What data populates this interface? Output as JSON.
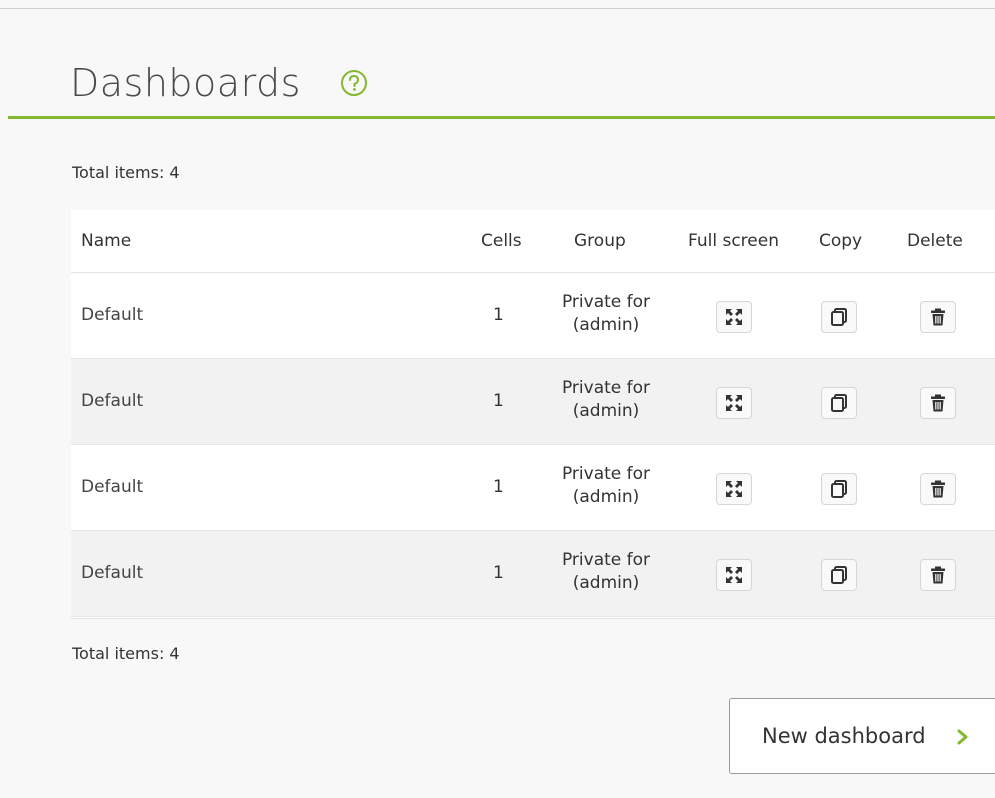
{
  "page": {
    "title": "Dashboards",
    "help_icon": "help-circle-icon",
    "accent_color": "#82b92e"
  },
  "summary": {
    "total_top": "Total items: 4",
    "total_bottom": "Total items: 4"
  },
  "table": {
    "columns": {
      "name": "Name",
      "cells": "Cells",
      "group": "Group",
      "full_screen": "Full screen",
      "copy": "Copy",
      "delete": "Delete"
    },
    "rows": [
      {
        "name": "Default",
        "cells": "1",
        "group": "Private for (admin)"
      },
      {
        "name": "Default",
        "cells": "1",
        "group": "Private for (admin)"
      },
      {
        "name": "Default",
        "cells": "1",
        "group": "Private for (admin)"
      },
      {
        "name": "Default",
        "cells": "1",
        "group": "Private for (admin)"
      }
    ],
    "row_icons": {
      "full_screen": "fullscreen-icon",
      "copy": "copy-icon",
      "delete": "trash-icon"
    }
  },
  "actions": {
    "new_dashboard_label": "New dashboard",
    "new_dashboard_icon": "chevron-right-icon"
  }
}
